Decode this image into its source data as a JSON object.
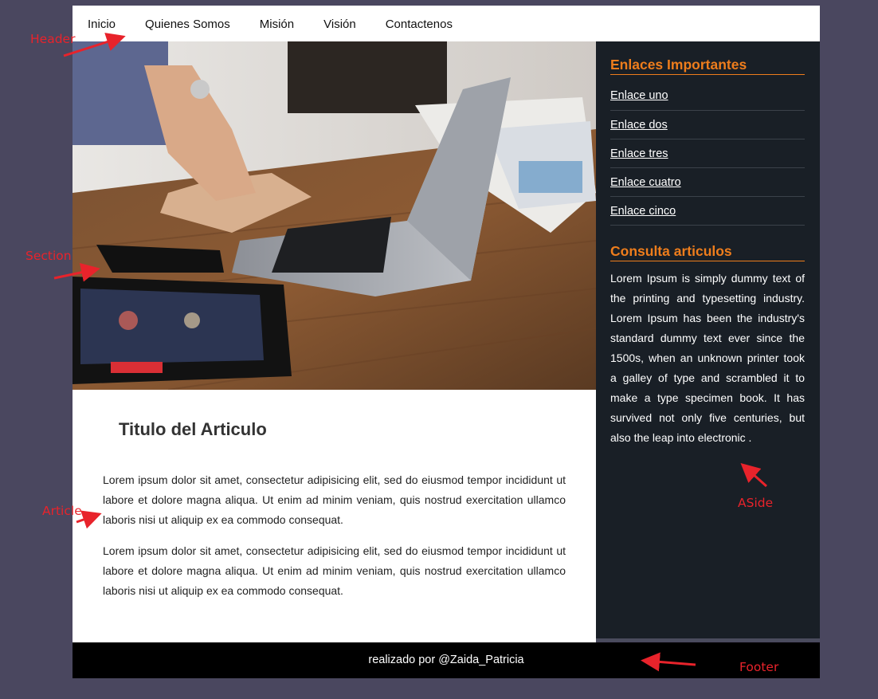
{
  "header": {
    "nav": [
      "Inicio",
      "Quienes Somos",
      "Misión",
      "Visión",
      "Contactenos"
    ]
  },
  "article": {
    "title": "Titulo del Articulo",
    "paragraphs": [
      "Lorem ipsum dolor sit amet, consectetur adipisicing elit, sed do eiusmod tempor incididunt ut labore et dolore magna aliqua. Ut enim ad minim veniam, quis nostrud exercitation ullamco laboris nisi ut aliquip ex ea commodo consequat.",
      "Lorem ipsum dolor sit amet, consectetur adipisicing elit, sed do eiusmod tempor incididunt ut labore et dolore magna aliqua. Ut enim ad minim veniam, quis nostrud exercitation ullamco laboris nisi ut aliquip ex ea commodo consequat."
    ]
  },
  "aside": {
    "links_title": "Enlaces Importantes",
    "links": [
      "Enlace uno",
      "Enlace dos",
      "Enlace tres",
      "Enlace cuatro",
      "Enlace cinco"
    ],
    "consulta_title": "Consulta articulos",
    "consulta_text": "Lorem Ipsum is simply dummy text of the printing and typesetting industry. Lorem Ipsum has been the industry's standard dummy text ever since the 1500s, when an unknown printer took a galley of type and scrambled it to make a type specimen book. It has survived not only five centuries, but also the leap into electronic ."
  },
  "footer": {
    "text": "realizado por @Zaida_Patricia"
  },
  "annotations": {
    "header": "Header",
    "section": "Section",
    "article": "Article",
    "aside": "ASide",
    "footer": "Footer"
  },
  "colors": {
    "background": "#4a475f",
    "aside_bg": "#191f26",
    "accent_orange": "#ee7d1c",
    "annotation_red": "#e8232b"
  },
  "icons": {
    "hero": "laptop-desk-photo"
  }
}
